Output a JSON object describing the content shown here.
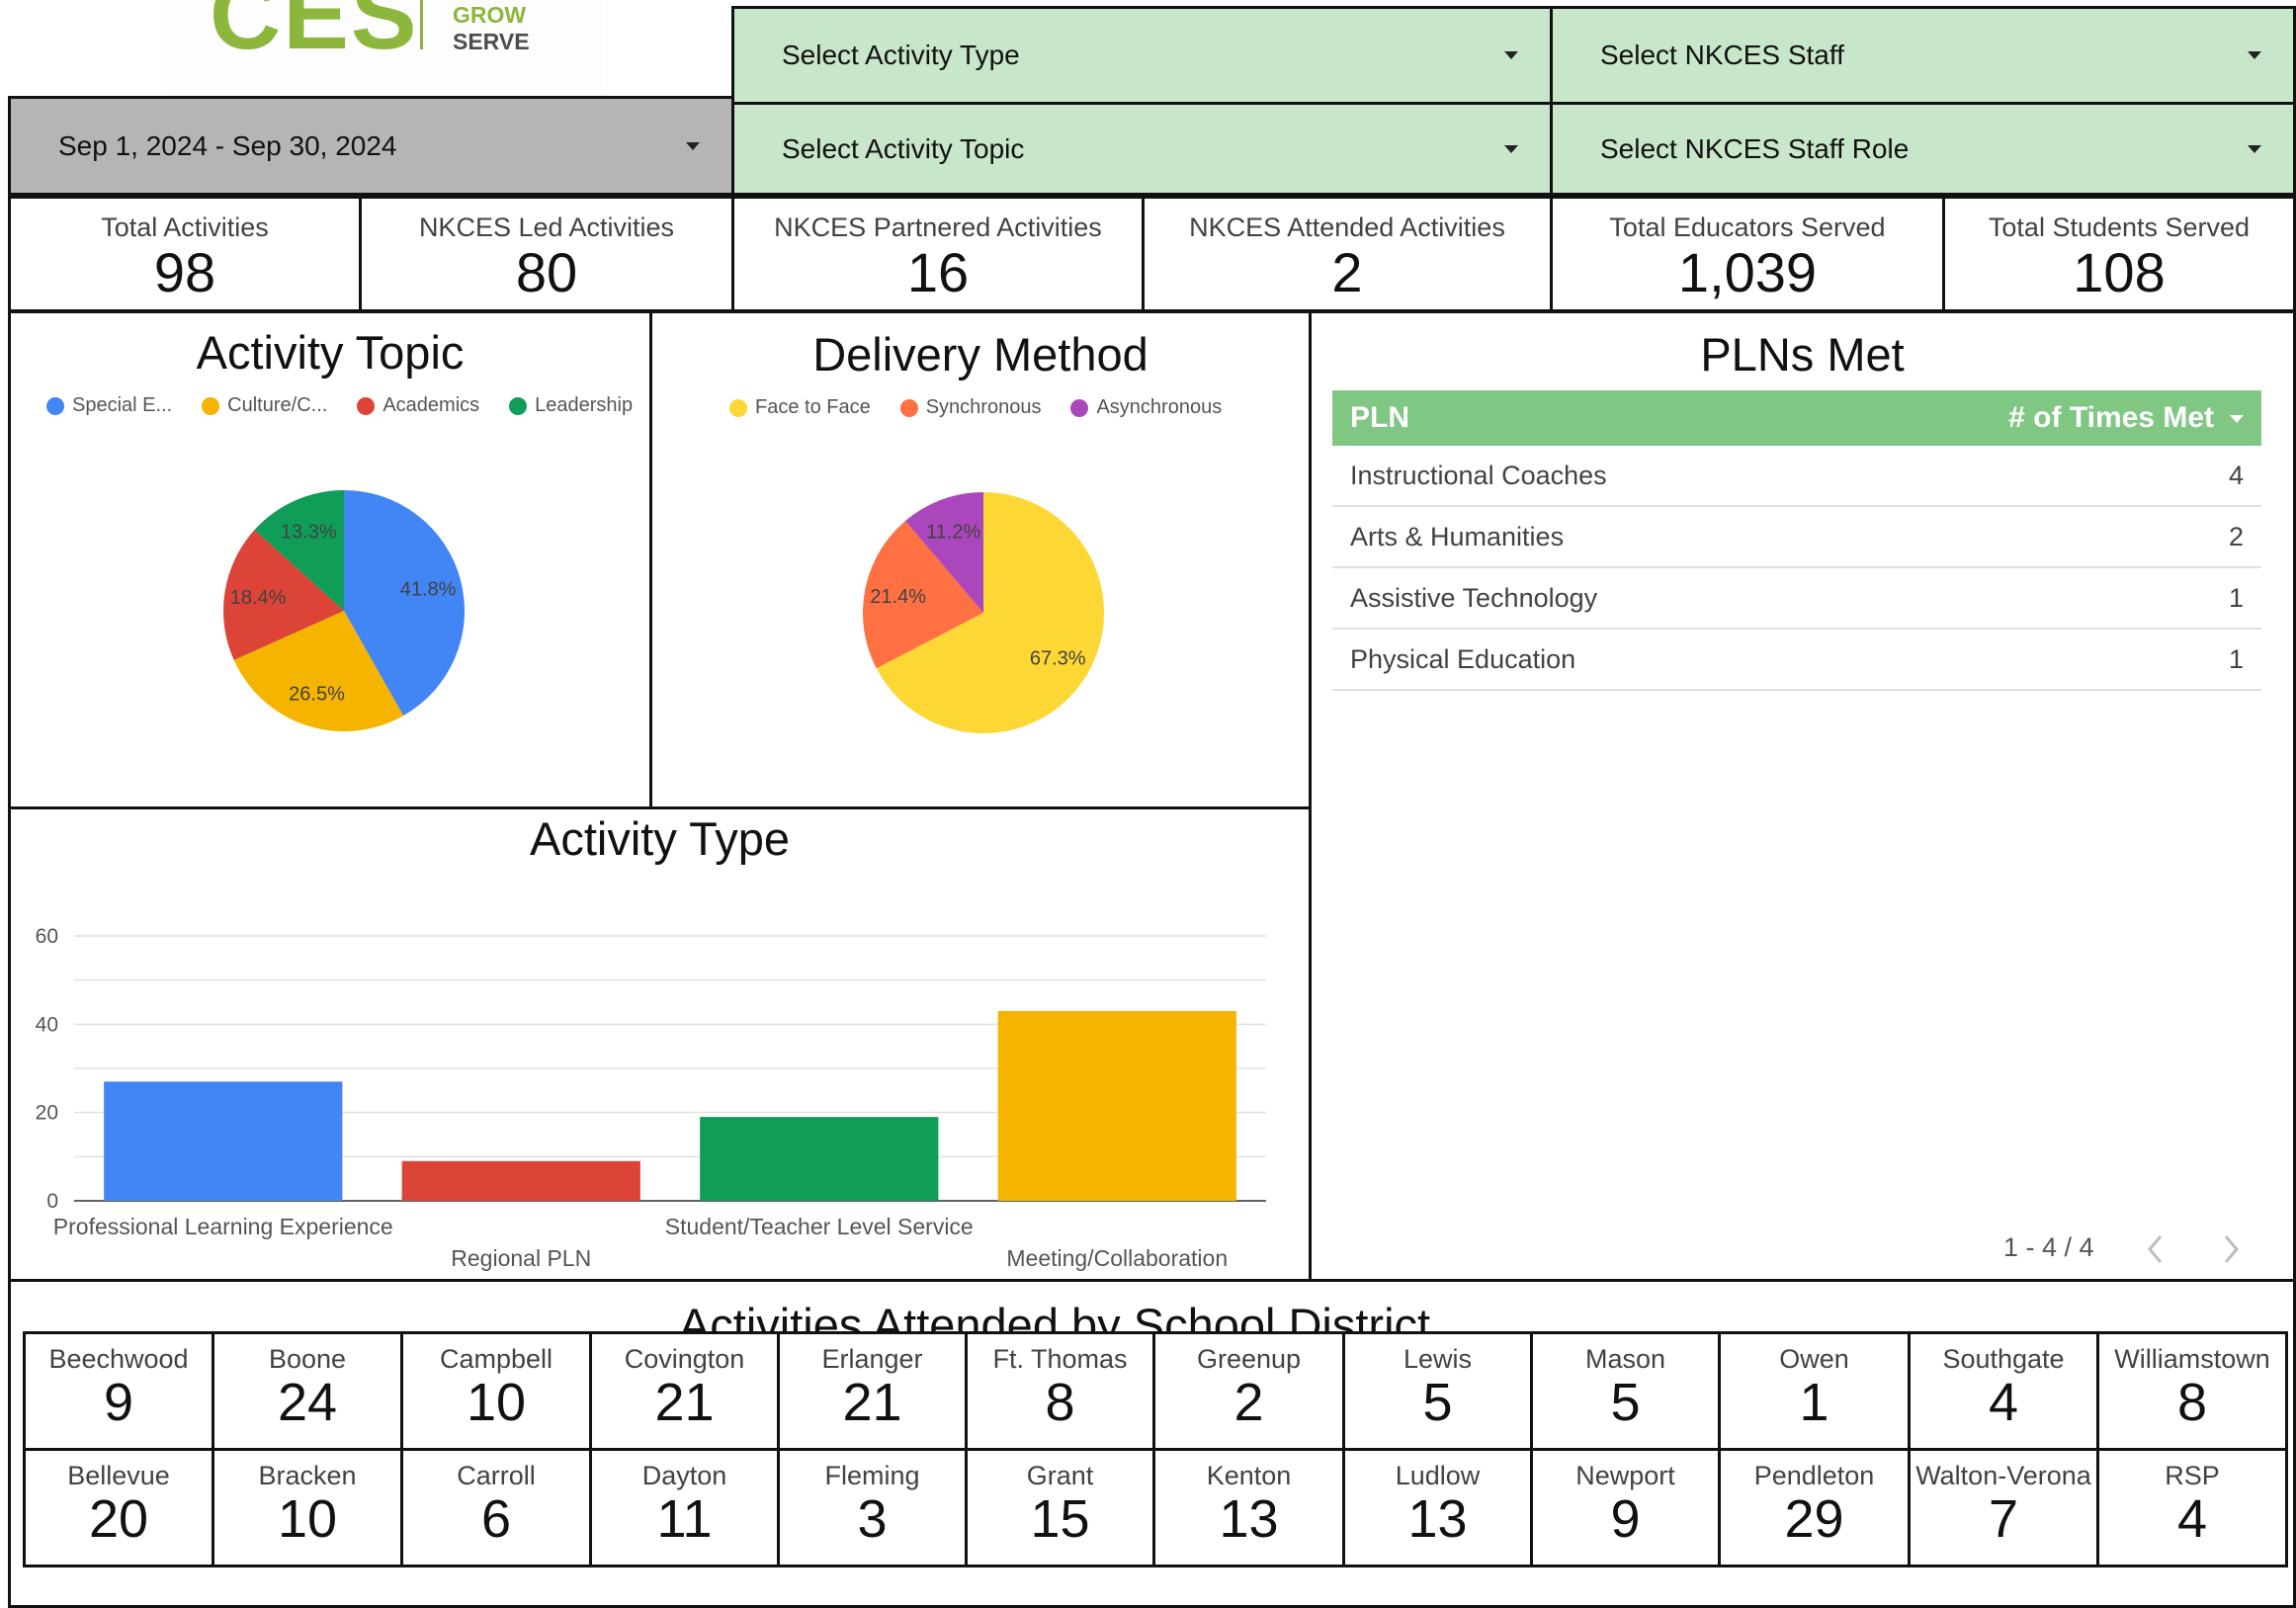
{
  "logo": {
    "letters": "CES",
    "line1": "GROW",
    "line2": "SERVE"
  },
  "filters": {
    "date_range": "Sep 1, 2024 - Sep 30, 2024",
    "activity_type": "Select Activity Type",
    "activity_topic": "Select Activity Topic",
    "staff": "Select NKCES Staff",
    "staff_role": "Select NKCES Staff Role"
  },
  "kpis": [
    {
      "label": "Total Activities",
      "value": "98"
    },
    {
      "label": "NKCES Led Activities",
      "value": "80"
    },
    {
      "label": "NKCES Partnered Activities",
      "value": "16"
    },
    {
      "label": "NKCES Attended Activities",
      "value": "2"
    },
    {
      "label": "Total Educators Served",
      "value": "1,039"
    },
    {
      "label": "Total Students Served",
      "value": "108"
    }
  ],
  "activity_topic": {
    "title": "Activity Topic",
    "legend": [
      {
        "label": "Special E...",
        "color": "#4285f4"
      },
      {
        "label": "Culture/C...",
        "color": "#f4b400"
      },
      {
        "label": "Academics",
        "color": "#db4437"
      },
      {
        "label": "Leadership",
        "color": "#0f9d58"
      }
    ]
  },
  "delivery_method": {
    "title": "Delivery Method",
    "legend": [
      {
        "label": "Face to Face",
        "color": "#fdd835"
      },
      {
        "label": "Synchronous",
        "color": "#ff7043"
      },
      {
        "label": "Asynchronous",
        "color": "#ab47bc"
      }
    ]
  },
  "activity_type": {
    "title": "Activity Type"
  },
  "chart_data": [
    {
      "type": "pie",
      "title": "Activity Topic",
      "categories": [
        "Special E...",
        "Culture/C...",
        "Academics",
        "Leadership"
      ],
      "values": [
        41.8,
        26.5,
        18.4,
        13.3
      ],
      "labels": [
        "41.8%",
        "26.5%",
        "18.4%",
        "13.3%"
      ],
      "colors": [
        "#4285f4",
        "#f4b400",
        "#db4437",
        "#0f9d58"
      ],
      "legend": "top"
    },
    {
      "type": "pie",
      "title": "Delivery Method",
      "categories": [
        "Face to Face",
        "Synchronous",
        "Asynchronous"
      ],
      "values": [
        67.3,
        21.4,
        11.2
      ],
      "labels": [
        "67.3%",
        "21.4%",
        "11.2%"
      ],
      "colors": [
        "#fdd835",
        "#ff7043",
        "#ab47bc"
      ],
      "legend": "top"
    },
    {
      "type": "bar",
      "title": "Activity Type",
      "categories": [
        "Professional Learning Experience",
        "Regional PLN",
        "Student/Teacher Level Service",
        "Meeting/Collaboration"
      ],
      "values": [
        27,
        9,
        19,
        43
      ],
      "colors": [
        "#4285f4",
        "#db4437",
        "#0f9d58",
        "#f4b400"
      ],
      "yticks": [
        "0",
        "20",
        "40",
        "60"
      ],
      "ylim": [
        0,
        60
      ],
      "grid": true
    }
  ],
  "plns": {
    "title": "PLNs Met",
    "col1": "PLN",
    "col2": "# of Times Met",
    "rows": [
      {
        "pln": "Instructional Coaches",
        "count": "4"
      },
      {
        "pln": "Arts & Humanities",
        "count": "2"
      },
      {
        "pln": "Assistive Technology",
        "count": "1"
      },
      {
        "pln": "Physical Education",
        "count": "1"
      }
    ],
    "pagination": "1 - 4 / 4"
  },
  "districts": {
    "title": "Activities Attended by School District",
    "row1": [
      {
        "name": "Beechwood",
        "value": "9"
      },
      {
        "name": "Boone",
        "value": "24"
      },
      {
        "name": "Campbell",
        "value": "10"
      },
      {
        "name": "Covington",
        "value": "21"
      },
      {
        "name": "Erlanger",
        "value": "21"
      },
      {
        "name": "Ft. Thomas",
        "value": "8"
      },
      {
        "name": "Greenup",
        "value": "2"
      },
      {
        "name": "Lewis",
        "value": "5"
      },
      {
        "name": "Mason",
        "value": "5"
      },
      {
        "name": "Owen",
        "value": "1"
      },
      {
        "name": "Southgate",
        "value": "4"
      },
      {
        "name": "Williamstown",
        "value": "8"
      }
    ],
    "row2": [
      {
        "name": "Bellevue",
        "value": "20"
      },
      {
        "name": "Bracken",
        "value": "10"
      },
      {
        "name": "Carroll",
        "value": "6"
      },
      {
        "name": "Dayton",
        "value": "11"
      },
      {
        "name": "Fleming",
        "value": "3"
      },
      {
        "name": "Grant",
        "value": "15"
      },
      {
        "name": "Kenton",
        "value": "13"
      },
      {
        "name": "Ludlow",
        "value": "13"
      },
      {
        "name": "Newport",
        "value": "9"
      },
      {
        "name": "Pendleton",
        "value": "29"
      },
      {
        "name": "Walton-Verona",
        "value": "7"
      },
      {
        "name": "RSP",
        "value": "4"
      }
    ]
  }
}
